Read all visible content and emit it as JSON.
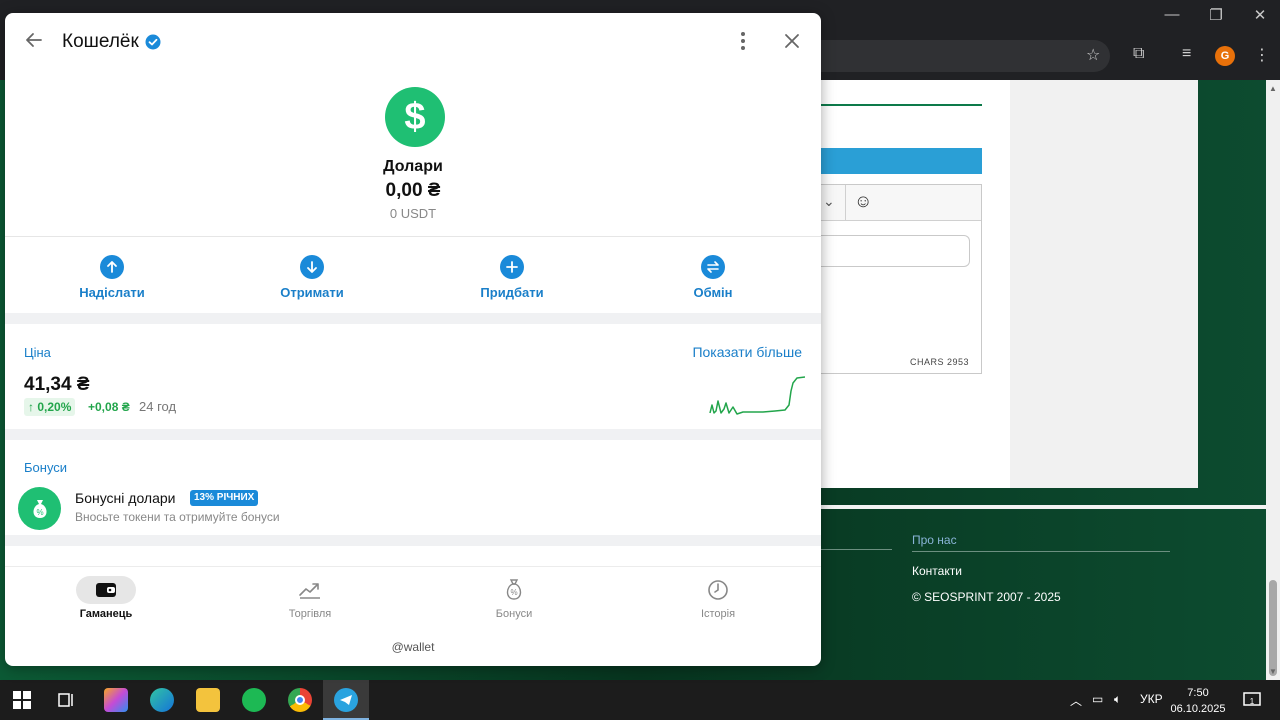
{
  "wallet": {
    "title": "Кошелёк",
    "asset": {
      "name": "Долари",
      "balance": "0,00 ₴",
      "sub": "0 USDT",
      "icon": "dollar-icon"
    },
    "actions": [
      {
        "label": "Надіслати",
        "icon": "arrow-up-icon"
      },
      {
        "label": "Отримати",
        "icon": "arrow-down-icon"
      },
      {
        "label": "Придбати",
        "icon": "plus-icon"
      },
      {
        "label": "Обмін",
        "icon": "exchange-icon"
      }
    ],
    "price": {
      "title": "Ціна",
      "show_more": "Показати більше",
      "value": "41,34 ₴",
      "change_pct": "↑ 0,20%",
      "change_abs": "+0,08 ₴",
      "period": "24 год",
      "trend_color": "#22a54b"
    },
    "bonuses": {
      "title": "Бонуси",
      "item_title": "Бонусні долари",
      "badge": "13% РІЧНИХ",
      "description": "Вносьте токени та отримуйте бонуси"
    },
    "nav": [
      {
        "label": "Гаманець",
        "icon": "wallet-icon",
        "active": true
      },
      {
        "label": "Торгівля",
        "icon": "trend-icon",
        "active": false
      },
      {
        "label": "Бонуси",
        "icon": "money-bag-icon",
        "active": false
      },
      {
        "label": "Історія",
        "icon": "clock-icon",
        "active": false
      }
    ],
    "handle": "@wallet",
    "accent_color": "#1a8ad9",
    "asset_color": "#1fbf73"
  },
  "background": {
    "profile_initial": "G",
    "editor_counter": "CHARS 2953",
    "footer_heading": "Про нас",
    "footer_links": [
      "Контакти",
      "© SEOSPRINT 2007 - 2025"
    ]
  },
  "taskbar": {
    "language": "УКР",
    "time": "7:50",
    "date": "06.10.2025",
    "notifications": "1"
  }
}
